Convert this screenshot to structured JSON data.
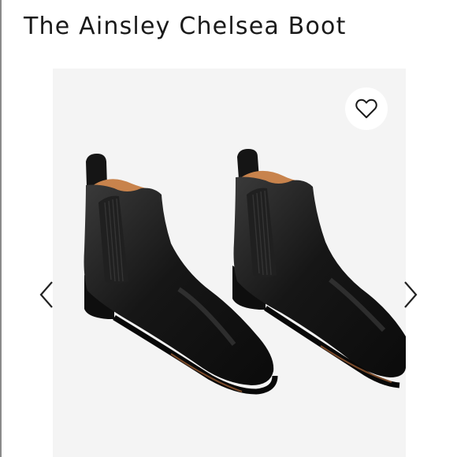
{
  "listing": {
    "title": "The Ainsley Chelsea Boot"
  },
  "icons": {
    "favorite": "heart-outline-icon",
    "previous": "chevron-left-icon",
    "next": "chevron-right-icon"
  },
  "colors": {
    "photo_background": "#f4f4f4",
    "boot_leather": "#141414",
    "boot_lining": "#c8834c"
  }
}
